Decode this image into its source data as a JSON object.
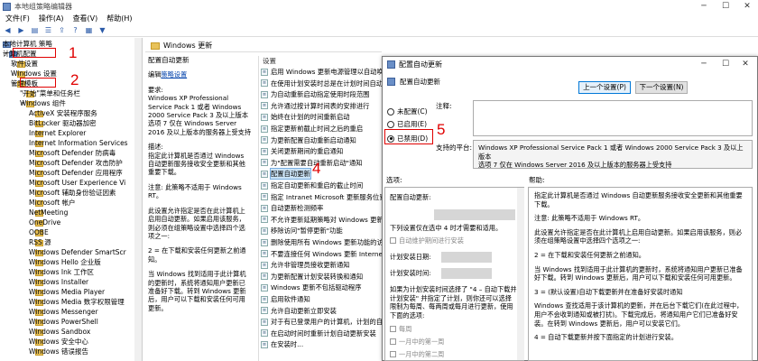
{
  "window": {
    "title": "本地组策略编辑器"
  },
  "menu": [
    "文件(F)",
    "操作(A)",
    "查看(V)",
    "帮助(H)"
  ],
  "toolbar_icons": [
    "back-icon",
    "forward-icon",
    "folder-icon",
    "list-icon",
    "export-icon",
    "help-icon",
    "properties-icon",
    "filter-icon"
  ],
  "tree": {
    "root": "本地计算机 策略",
    "computer_config": "计算机配置",
    "software_settings": "软件设置",
    "windows_settings": "Windows 设置",
    "admin_templates": "管理模板",
    "start_menu": "\"开始\"菜单和任务栏",
    "windows_components": "Windows 组件",
    "items": [
      "ActiveX 安装程序服务",
      "BitLocker 驱动器加密",
      "Internet Explorer",
      "Internet Information Services",
      "Microsoft Defender 防病毒",
      "Microsoft Defender 攻击防护",
      "Microsoft Defender 应用程序",
      "Microsoft User Experience Vi",
      "Microsoft 辅助身份验证因素",
      "Microsoft 帐户",
      "NetMeeting",
      "OneDrive",
      "OOBE",
      "RSS 源",
      "Windows Defender SmartScr",
      "Windows Hello 企业版",
      "Windows Ink 工作区",
      "Windows Installer",
      "Windows Media Player",
      "Windows Media 数字权限管理",
      "Windows Messenger",
      "Windows PowerShell",
      "Windows Sandbox",
      "Windows 安全中心",
      "Windows 错误报告"
    ]
  },
  "middle": {
    "header": "Windows 更新",
    "policy_title": "配置自动更新",
    "edit_prefix": "编辑",
    "edit_link": "策略设置",
    "desc": [
      "要求:\nWindows XP Professional Service Pack 1 或者 Windows 2000 Service Pack 3 及以上版本 选项 7 仅在 Windows Server 2016 及以上版本的服务器上受支持",
      "描述:\n指定此计算机是否通过 Windows 自动更新服务接收安全更新和其他重要下载。",
      "注意: 此策略不适用于 Windows RT。",
      "此设置允许指定是否在此计算机上启用自动更新。如果启用该服务，则必须在组策略设置中选择四个选项之一:",
      "2 = 在下载和安装任何更新之前通知。",
      "当 Windows 找到适用于此计算机的更新时，系统将通知用户更新已准备好下载。转到 Windows 更新后，用户可以下载和安装任何可用更新。"
    ]
  },
  "list": {
    "header": "设置",
    "items": [
      "启用 Windows 更新电源管理以自动唤醒",
      "在使用计划安装时总是在计划时间自动",
      "为自动重新启动指定使用时段范围",
      "允许通过按计算时间表的安排进行",
      "始终在计划的时间重新启动",
      "指定更新前截止时间之后的重启",
      "为更新配置自动重新启动通知",
      "关闭更新期间的重启通知",
      "为\"配置需要自动重新启动\"通知",
      "配置自动更新",
      "指定自动更新和重启的截止时间",
      "指定 Intranet Microsoft 更新服务位置",
      "自动更新检测频率",
      "不允许更新延期策略对 Windows 更新",
      "移除访问\"暂停更新\"功能",
      "删除使用所有 Windows 更新功能的访问权",
      "不要连接任何 Windows 更新 Internet 位",
      "允许非管理员接收更新通知",
      "为更新配置计划安装转换和通知",
      "Windows 更新不包括驱动程序",
      "启用软件通知",
      "允许自动更新立即安装",
      "对于有已登录用户的计算机，计划的自动",
      "在启动时间时重新计划自动更新安装",
      "在安装时..."
    ],
    "selected_index": 9
  },
  "dialog": {
    "title": "配置自动更新",
    "subtitle": "配置自动更新",
    "prev_button": "上一个设置(P)",
    "next_button": "下一个设置(N)",
    "radio_not_configured": "未配置(C)",
    "radio_enabled": "已启用(E)",
    "radio_disabled": "已禁用(D)",
    "comment_label": "注释:",
    "supported_label": "支持的平台:",
    "supported_text": "Windows XP Professional Service Pack 1 或者 Windows 2000 Service Pack 3 及以上版本\n选项 7 仅在 Windows Server 2016 及以上版本的服务器上受支持",
    "options_label": "选项:",
    "help_label": "帮助:",
    "options": {
      "title": "配置自动更新:",
      "download_line": "下列设置仅在选中 4 时才需要和适用。",
      "maintenance": "自动维护期间进行安装",
      "day_label": "计划安装日期:",
      "time_label": "计划安装时间:",
      "note": "如果为计划安装时间选择了 \"4 – 自动下载并计划安装\" 并指定了计划，则你还可以选择限制为每周、每两周或每月进行更新，使用下面的选项:",
      "weekly": "每周",
      "first_week": "一月中的第一周",
      "second_week": "一月中的第二周"
    },
    "help_paragraphs": [
      "指定此计算机是否通过 Windows 自动更新服务接收安全更新和其他重要下载。",
      "注意: 此策略不适用于 Windows RT。",
      "此设置允许指定是否在此计算机上启用自动更新。如果启用该服务，则必须在组策略设置中选择四个选项之一:",
      "2 = 在下载和安装任何更新之前通知。",
      "当 Windows 找到适用于此计算机的更新时，系统将通知用户更新已准备好下载。转到 Windows 更新后，用户可以下载和安装任何可用更新。",
      "3 = (默认设置)自动下载更新并在准备好安装时通知",
      "Windows 查找适用于该计算机的更新，并在后台下载它们(在此过程中，用户不会收到通知或被打扰)。下载完成后，将通知用户它们已准备好安装。在转到 Windows 更新后，用户可以安装它们。",
      "4 = 自动下载更新并按下面指定的计划进行安装。"
    ]
  },
  "annotations": [
    "1",
    "2",
    "4",
    "5"
  ]
}
